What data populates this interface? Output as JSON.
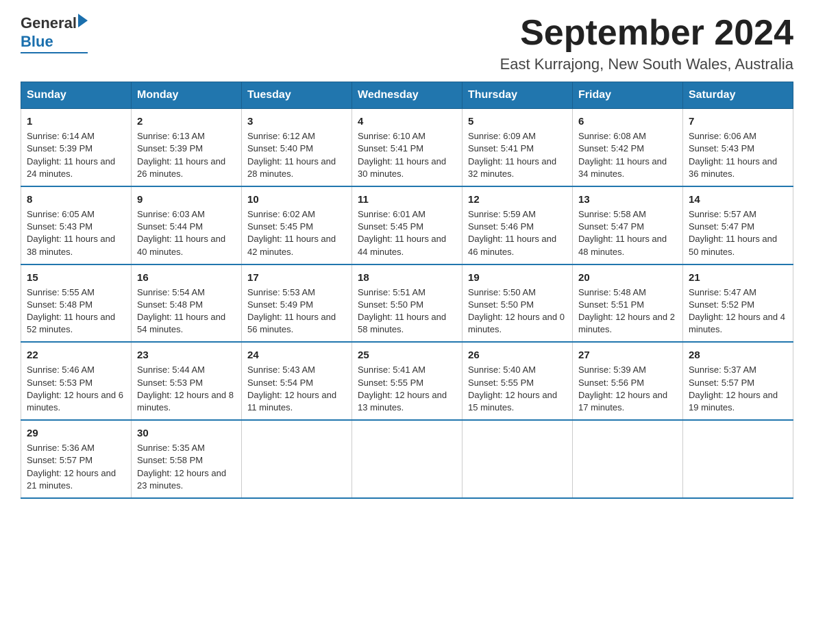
{
  "header": {
    "title": "September 2024",
    "location": "East Kurrajong, New South Wales, Australia",
    "logo_general": "General",
    "logo_blue": "Blue"
  },
  "weekdays": [
    "Sunday",
    "Monday",
    "Tuesday",
    "Wednesday",
    "Thursday",
    "Friday",
    "Saturday"
  ],
  "weeks": [
    [
      {
        "day": "1",
        "sunrise": "6:14 AM",
        "sunset": "5:39 PM",
        "daylight": "11 hours and 24 minutes."
      },
      {
        "day": "2",
        "sunrise": "6:13 AM",
        "sunset": "5:39 PM",
        "daylight": "11 hours and 26 minutes."
      },
      {
        "day": "3",
        "sunrise": "6:12 AM",
        "sunset": "5:40 PM",
        "daylight": "11 hours and 28 minutes."
      },
      {
        "day": "4",
        "sunrise": "6:10 AM",
        "sunset": "5:41 PM",
        "daylight": "11 hours and 30 minutes."
      },
      {
        "day": "5",
        "sunrise": "6:09 AM",
        "sunset": "5:41 PM",
        "daylight": "11 hours and 32 minutes."
      },
      {
        "day": "6",
        "sunrise": "6:08 AM",
        "sunset": "5:42 PM",
        "daylight": "11 hours and 34 minutes."
      },
      {
        "day": "7",
        "sunrise": "6:06 AM",
        "sunset": "5:43 PM",
        "daylight": "11 hours and 36 minutes."
      }
    ],
    [
      {
        "day": "8",
        "sunrise": "6:05 AM",
        "sunset": "5:43 PM",
        "daylight": "11 hours and 38 minutes."
      },
      {
        "day": "9",
        "sunrise": "6:03 AM",
        "sunset": "5:44 PM",
        "daylight": "11 hours and 40 minutes."
      },
      {
        "day": "10",
        "sunrise": "6:02 AM",
        "sunset": "5:45 PM",
        "daylight": "11 hours and 42 minutes."
      },
      {
        "day": "11",
        "sunrise": "6:01 AM",
        "sunset": "5:45 PM",
        "daylight": "11 hours and 44 minutes."
      },
      {
        "day": "12",
        "sunrise": "5:59 AM",
        "sunset": "5:46 PM",
        "daylight": "11 hours and 46 minutes."
      },
      {
        "day": "13",
        "sunrise": "5:58 AM",
        "sunset": "5:47 PM",
        "daylight": "11 hours and 48 minutes."
      },
      {
        "day": "14",
        "sunrise": "5:57 AM",
        "sunset": "5:47 PM",
        "daylight": "11 hours and 50 minutes."
      }
    ],
    [
      {
        "day": "15",
        "sunrise": "5:55 AM",
        "sunset": "5:48 PM",
        "daylight": "11 hours and 52 minutes."
      },
      {
        "day": "16",
        "sunrise": "5:54 AM",
        "sunset": "5:48 PM",
        "daylight": "11 hours and 54 minutes."
      },
      {
        "day": "17",
        "sunrise": "5:53 AM",
        "sunset": "5:49 PM",
        "daylight": "11 hours and 56 minutes."
      },
      {
        "day": "18",
        "sunrise": "5:51 AM",
        "sunset": "5:50 PM",
        "daylight": "11 hours and 58 minutes."
      },
      {
        "day": "19",
        "sunrise": "5:50 AM",
        "sunset": "5:50 PM",
        "daylight": "12 hours and 0 minutes."
      },
      {
        "day": "20",
        "sunrise": "5:48 AM",
        "sunset": "5:51 PM",
        "daylight": "12 hours and 2 minutes."
      },
      {
        "day": "21",
        "sunrise": "5:47 AM",
        "sunset": "5:52 PM",
        "daylight": "12 hours and 4 minutes."
      }
    ],
    [
      {
        "day": "22",
        "sunrise": "5:46 AM",
        "sunset": "5:53 PM",
        "daylight": "12 hours and 6 minutes."
      },
      {
        "day": "23",
        "sunrise": "5:44 AM",
        "sunset": "5:53 PM",
        "daylight": "12 hours and 8 minutes."
      },
      {
        "day": "24",
        "sunrise": "5:43 AM",
        "sunset": "5:54 PM",
        "daylight": "12 hours and 11 minutes."
      },
      {
        "day": "25",
        "sunrise": "5:41 AM",
        "sunset": "5:55 PM",
        "daylight": "12 hours and 13 minutes."
      },
      {
        "day": "26",
        "sunrise": "5:40 AM",
        "sunset": "5:55 PM",
        "daylight": "12 hours and 15 minutes."
      },
      {
        "day": "27",
        "sunrise": "5:39 AM",
        "sunset": "5:56 PM",
        "daylight": "12 hours and 17 minutes."
      },
      {
        "day": "28",
        "sunrise": "5:37 AM",
        "sunset": "5:57 PM",
        "daylight": "12 hours and 19 minutes."
      }
    ],
    [
      {
        "day": "29",
        "sunrise": "5:36 AM",
        "sunset": "5:57 PM",
        "daylight": "12 hours and 21 minutes."
      },
      {
        "day": "30",
        "sunrise": "5:35 AM",
        "sunset": "5:58 PM",
        "daylight": "12 hours and 23 minutes."
      },
      null,
      null,
      null,
      null,
      null
    ]
  ],
  "labels": {
    "sunrise": "Sunrise:",
    "sunset": "Sunset:",
    "daylight": "Daylight:"
  }
}
